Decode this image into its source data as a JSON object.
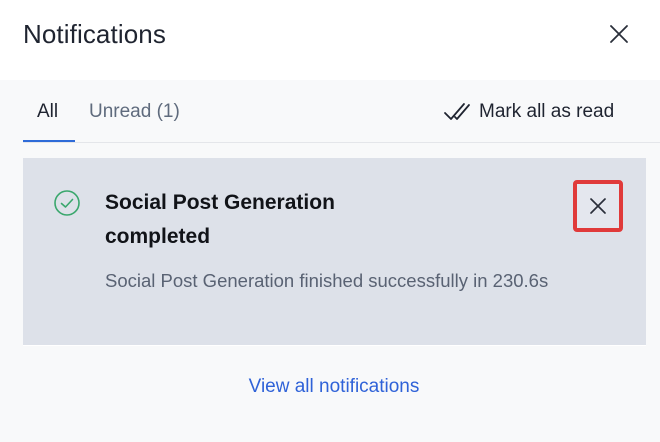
{
  "panel": {
    "title": "Notifications",
    "close_icon": "close-icon"
  },
  "tabs": [
    {
      "label": "All",
      "selected": true
    },
    {
      "label": "Unread (1)",
      "selected": false
    }
  ],
  "mark_all": {
    "label": "Mark all as read",
    "icon": "double-check-icon"
  },
  "notifications": [
    {
      "status_icon": "check-circle-icon",
      "status_color": "#3aa76d",
      "title": "Social Post Generation completed",
      "body": "Social Post Generation finished successfully in 230.6s",
      "dismiss_icon": "close-icon"
    }
  ],
  "footer": {
    "view_all_label": "View all notifications"
  },
  "colors": {
    "accent": "#2e6bd8",
    "link": "#2f62d8",
    "highlight_border": "#e03a3a",
    "card_background": "#dde1e9"
  }
}
